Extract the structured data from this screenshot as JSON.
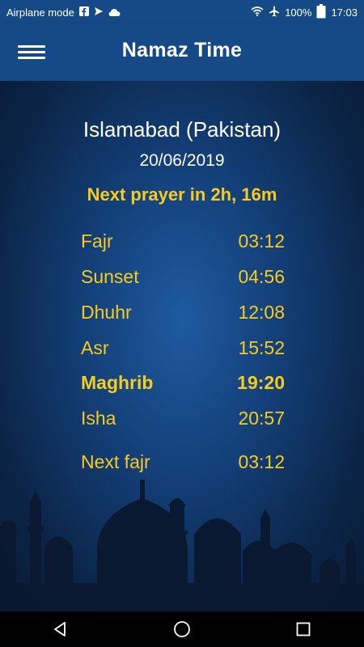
{
  "status_bar": {
    "left_text": "Airplane mode",
    "battery": "100%",
    "time": "17:03",
    "left_icons": [
      "facebook-icon",
      "send-icon",
      "cloud-icon"
    ],
    "right_icons": [
      "wifi-icon",
      "airplane-icon",
      "battery-icon"
    ]
  },
  "app_bar": {
    "title": "Namaz Time",
    "menu_icon": "hamburger-menu-icon"
  },
  "location": {
    "city": "Islamabad (Pakistan)",
    "date": "20/06/2019"
  },
  "next_prayer_text": "Next prayer in 2h, 16m",
  "prayers": [
    {
      "name": "Fajr",
      "time": "03:12"
    },
    {
      "name": "Sunset",
      "time": "04:56"
    },
    {
      "name": "Dhuhr",
      "time": "12:08"
    },
    {
      "name": "Asr",
      "time": "15:52"
    },
    {
      "name": "Maghrib",
      "time": "19:20",
      "current": true
    },
    {
      "name": "Isha",
      "time": "20:57"
    }
  ],
  "next_fajr": {
    "name": "Next fajr",
    "time": "03:12"
  },
  "colors": {
    "app_bar": "#154a86",
    "accent_yellow": "#f5cc1f",
    "nav_bar": "#000000"
  },
  "nav_bar": {
    "icons": [
      "back-triangle-icon",
      "home-circle-icon",
      "recents-square-icon"
    ]
  }
}
